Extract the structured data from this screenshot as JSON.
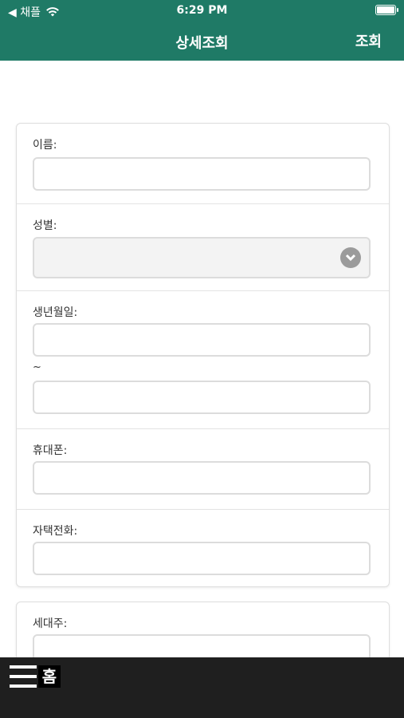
{
  "status_bar": {
    "back_label": "◀ 채플",
    "time": "6:29 PM",
    "wifi_icon": "wifi-icon",
    "battery_icon": "battery-icon"
  },
  "header": {
    "title": "상세조회",
    "action_label": "조회"
  },
  "form": {
    "name": {
      "label": "이름:",
      "value": ""
    },
    "gender": {
      "label": "성별:",
      "value": ""
    },
    "birth": {
      "label": "생년월일:",
      "from": "",
      "separator": "~",
      "to": ""
    },
    "mobile": {
      "label": "휴대폰:",
      "value": ""
    },
    "home_phone": {
      "label": "자택전화:",
      "value": ""
    },
    "household_head": {
      "label": "세대주:",
      "value": ""
    }
  },
  "bottom_bar": {
    "menu_icon": "menu-icon",
    "home_label": "홈"
  },
  "colors": {
    "header_bg": "#1f7a66",
    "bottom_bg": "#1f1f1f",
    "input_border": "#dcdcdc"
  }
}
